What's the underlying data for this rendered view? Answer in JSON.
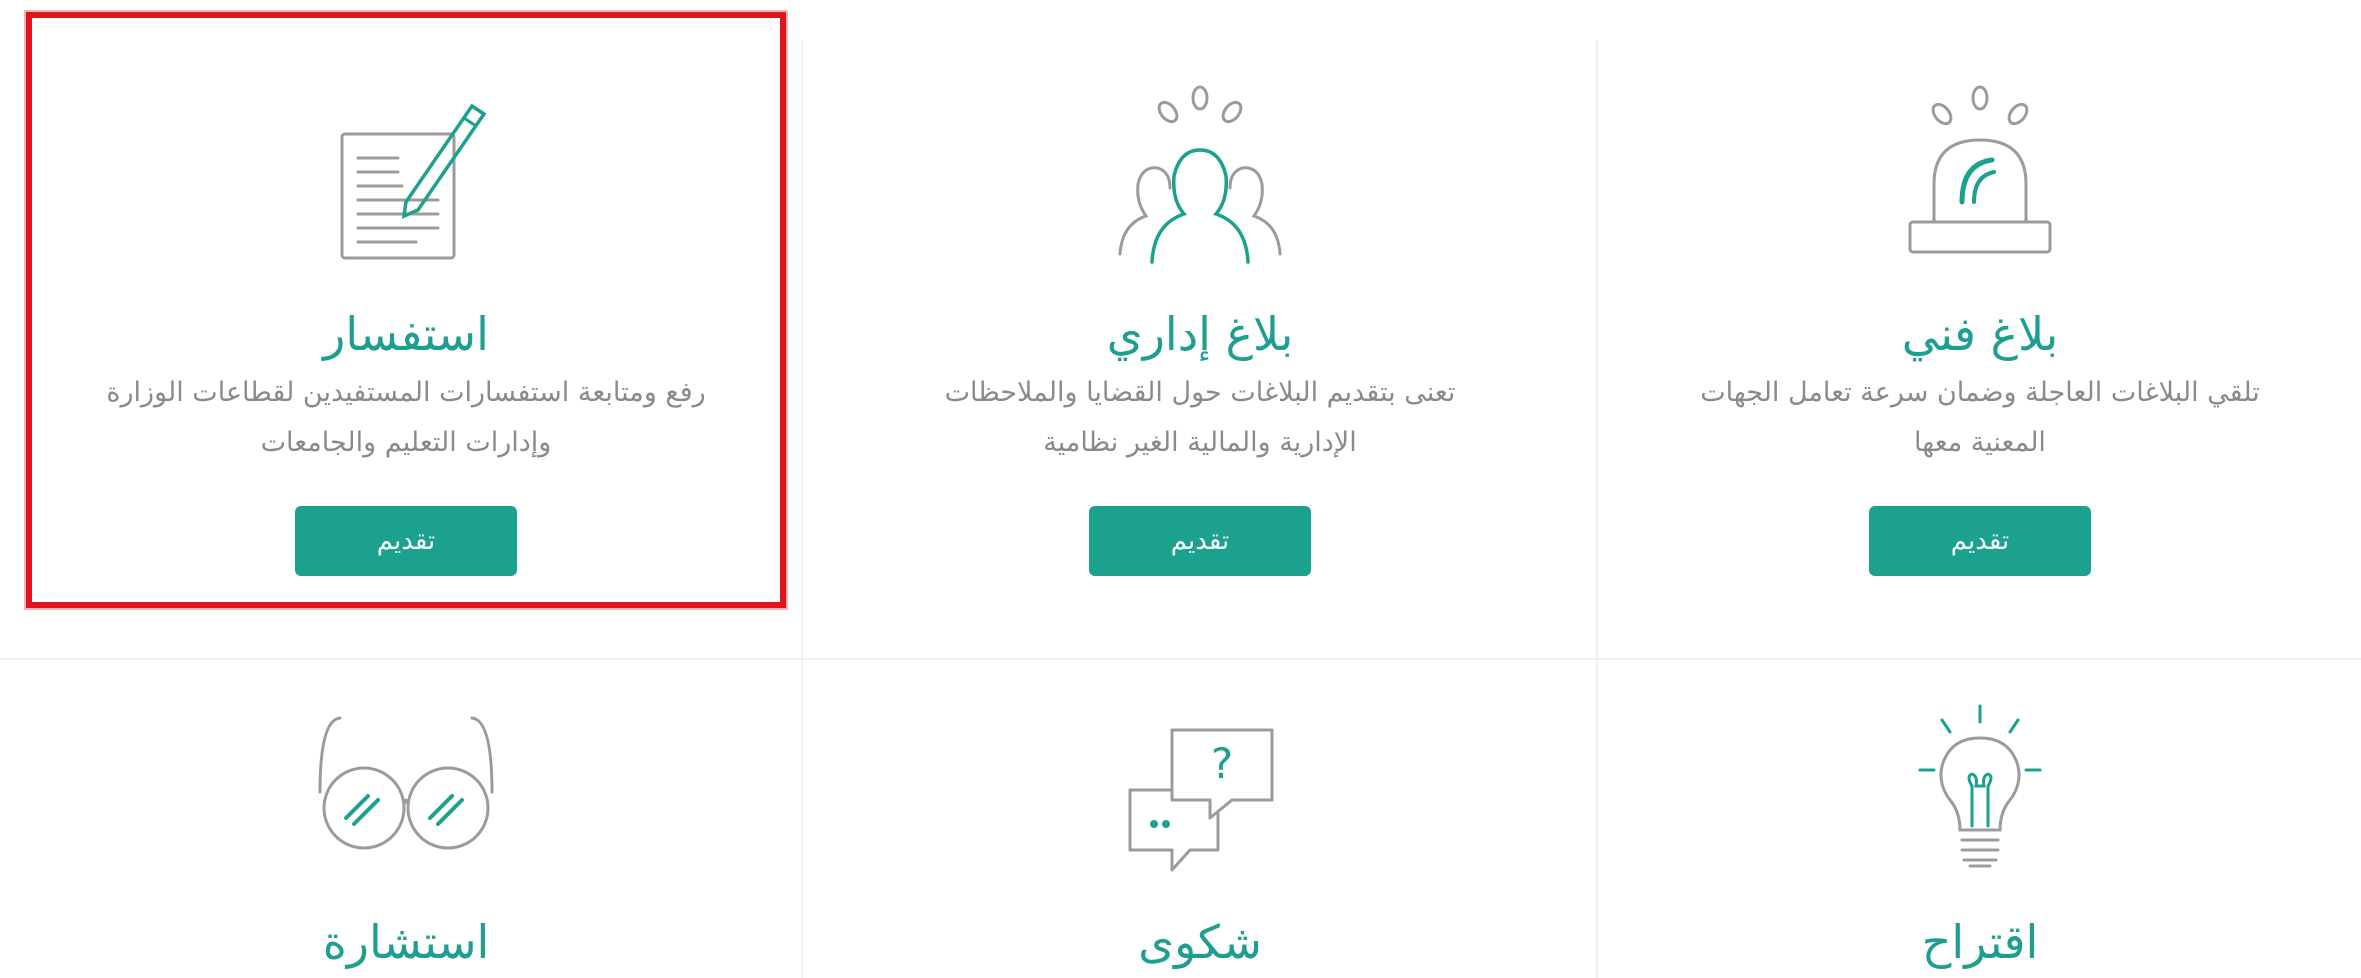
{
  "colors": {
    "accent": "#1ca18f",
    "title": "#1e9e8f",
    "text": "#8a8a8a",
    "icon": "#9b9b9b",
    "selection_border": "#e1141b"
  },
  "cards": [
    {
      "id": "technical-report",
      "title": "بلاغ فني",
      "description_lines": [
        "تلقي البلاغات العاجلة وضمان سرعة تعامل الجهات",
        "المعنية معها"
      ],
      "button": "تقديم",
      "icon": "alarm-siren-icon"
    },
    {
      "id": "administrative-report",
      "title": "بلاغ إداري",
      "description_lines": [
        "تعنى بتقديم البلاغات حول القضايا والملاحظات",
        "الإدارية والمالية الغير نظامية"
      ],
      "button": "تقديم",
      "icon": "group-people-icon"
    },
    {
      "id": "inquiry",
      "title": "استفسار",
      "description_lines": [
        "رفع ومتابعة استفسارات المستفيدين لقطاعات الوزارة",
        "وإدارات التعليم والجامعات"
      ],
      "button": "تقديم",
      "icon": "document-pen-icon"
    },
    {
      "id": "suggestion",
      "title": "اقتراح",
      "icon": "lightbulb-icon"
    },
    {
      "id": "complaint",
      "title": "شكوى",
      "icon": "speech-bubbles-icon"
    },
    {
      "id": "consultation",
      "title": "استشارة",
      "icon": "glasses-icon"
    }
  ]
}
